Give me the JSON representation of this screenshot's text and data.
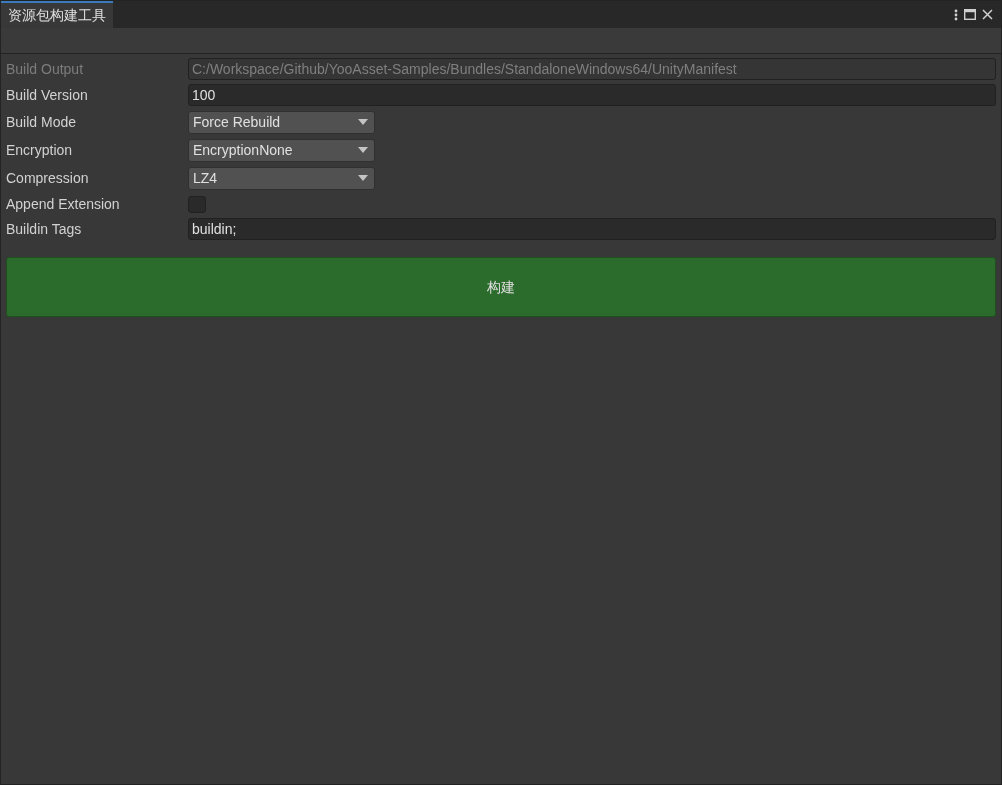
{
  "window": {
    "tab_title": "资源包构建工具"
  },
  "fields": [
    {
      "kind": "text",
      "label": "Build Output",
      "value": "C:/Workspace/Github/YooAsset-Samples/Bundles/StandaloneWindows64/UnityManifest",
      "disabled": true
    },
    {
      "kind": "text",
      "label": "Build Version",
      "value": "100",
      "disabled": false
    },
    {
      "kind": "dropdown",
      "label": "Build Mode",
      "value": "Force Rebuild",
      "disabled": false
    },
    {
      "kind": "dropdown",
      "label": "Encryption",
      "value": "EncryptionNone",
      "disabled": false
    },
    {
      "kind": "dropdown",
      "label": "Compression",
      "value": "LZ4",
      "disabled": false
    },
    {
      "kind": "checkbox",
      "label": "Append Extension",
      "checked": false,
      "disabled": false
    },
    {
      "kind": "text",
      "label": "Buildin Tags",
      "value": "buildin;",
      "disabled": false
    }
  ],
  "build_button": "构建"
}
